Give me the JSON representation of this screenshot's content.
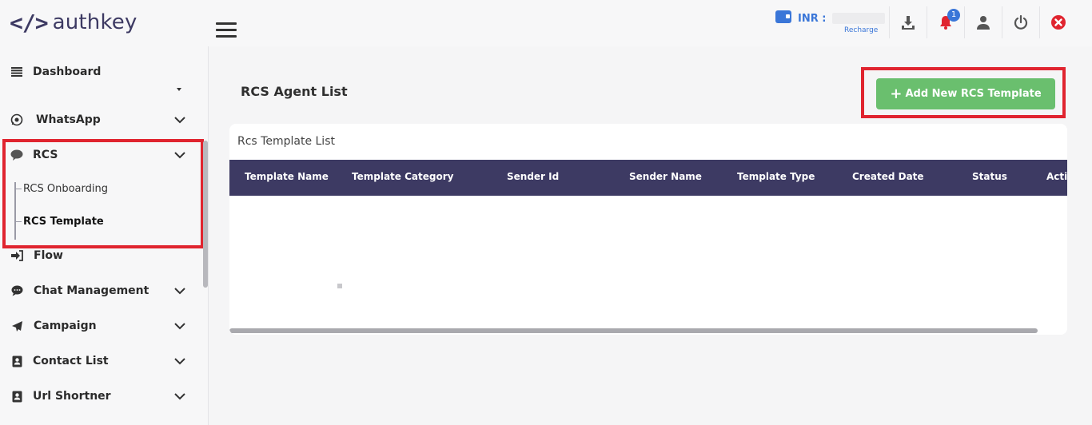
{
  "header": {
    "logo_mark": "</>",
    "logo_text": "authkey",
    "wallet_label": "INR :",
    "wallet_recharge": "Recharge",
    "notification_count": "1",
    "colors": {
      "accent": "#3a76d8",
      "brand": "#3d3a63",
      "danger": "#e0242f"
    }
  },
  "sidebar": {
    "items": [
      {
        "label": "Dashboard",
        "icon": "list-icon"
      },
      {
        "label": "WhatsApp",
        "icon": "whatsapp-icon"
      },
      {
        "label": "RCS",
        "icon": "chat-bubble-icon",
        "expanded": true
      },
      {
        "label": "Flow",
        "icon": "sign-in-icon"
      },
      {
        "label": "Chat Management",
        "icon": "comment-icon"
      },
      {
        "label": "Campaign",
        "icon": "paper-plane-icon"
      },
      {
        "label": "Contact List",
        "icon": "contact-book-icon"
      },
      {
        "label": "Url Shortner",
        "icon": "contact-book-icon"
      }
    ],
    "rcs_sub": [
      {
        "label": "RCS Onboarding"
      },
      {
        "label": "RCS Template",
        "active": true
      }
    ]
  },
  "main": {
    "page_title": "RCS Agent List",
    "add_button": "Add New RCS Template",
    "add_button_color": "#6abf6e",
    "card_title": "Rcs Template List",
    "columns": [
      "Template Name",
      "Template Category",
      "Sender Id",
      "Sender Name",
      "Template Type",
      "Created Date",
      "Status",
      "Acti"
    ]
  }
}
